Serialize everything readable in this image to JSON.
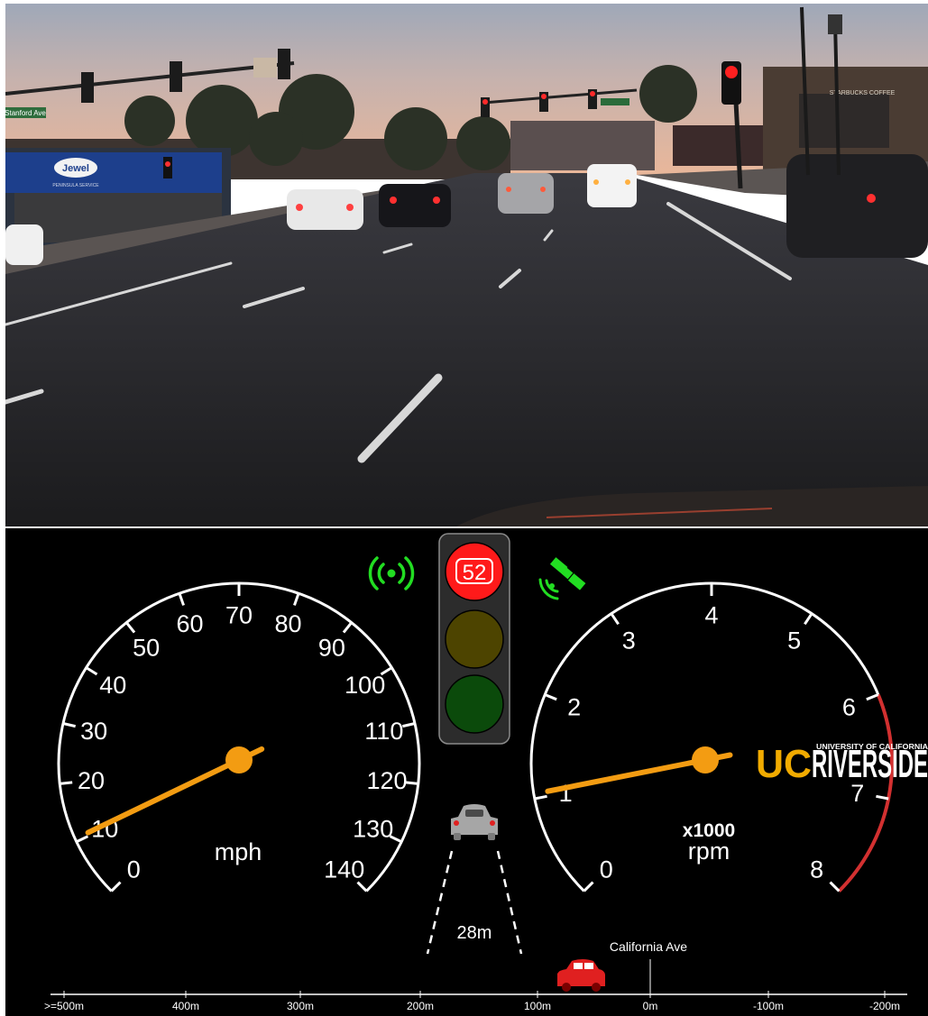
{
  "camera_view": {
    "street_sign": "Stanford Ave",
    "store_logo": "Jewel",
    "store_sub": "PENINSULA SERVICE",
    "cafe_sign": "STARBUCKS COFFEE"
  },
  "status_icons": {
    "connectivity": "wireless-signal-icon",
    "gps": "satellite-icon",
    "color": "#22dd22"
  },
  "traffic_light": {
    "countdown": "52",
    "active": "red",
    "colors": {
      "red": "#ff1a1a",
      "yellow_off": "#4d4400",
      "green_off": "#0b4a0b"
    }
  },
  "speedometer": {
    "unit": "mph",
    "ticks": [
      "0",
      "10",
      "20",
      "30",
      "40",
      "50",
      "60",
      "70",
      "80",
      "90",
      "100",
      "110",
      "120",
      "130",
      "140"
    ],
    "value": 10,
    "min": 0,
    "max": 140,
    "needle_color": "#f39c12"
  },
  "tachometer": {
    "unit_line1": "x1000",
    "unit_line2": "rpm",
    "ticks": [
      "0",
      "1",
      "2",
      "3",
      "4",
      "5",
      "6",
      "7",
      "8"
    ],
    "value": 1,
    "min": 0,
    "max": 8,
    "redline_from": 6,
    "redline_color": "#d23030",
    "needle_color": "#f39c12"
  },
  "lead_vehicle": {
    "distance": "28m",
    "icon": "car-icon"
  },
  "brand": {
    "uc": "UC",
    "riverside": "RIVERSIDE",
    "tagline": "UNIVERSITY OF CALIFORNIA",
    "uc_color": "#f1ab00"
  },
  "timeline": {
    "street": "California Ave",
    "labels": [
      ">=500m",
      "400m",
      "300m",
      "200m",
      "100m",
      "0m",
      "-100m",
      "-200m"
    ],
    "car_icon": "car-icon",
    "car_color": "#e02020"
  }
}
